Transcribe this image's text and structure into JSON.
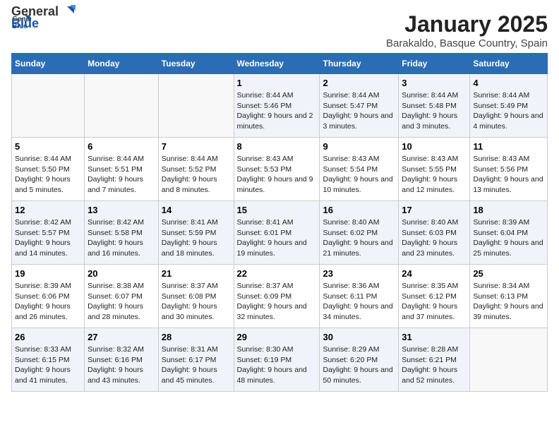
{
  "logo": {
    "general": "General",
    "blue": "Blue"
  },
  "title": "January 2025",
  "subtitle": "Barakaldo, Basque Country, Spain",
  "days_of_week": [
    "Sunday",
    "Monday",
    "Tuesday",
    "Wednesday",
    "Thursday",
    "Friday",
    "Saturday"
  ],
  "weeks": [
    [
      {
        "day": "",
        "content": ""
      },
      {
        "day": "",
        "content": ""
      },
      {
        "day": "",
        "content": ""
      },
      {
        "day": "1",
        "content": "Sunrise: 8:44 AM\nSunset: 5:46 PM\nDaylight: 9 hours and 2 minutes."
      },
      {
        "day": "2",
        "content": "Sunrise: 8:44 AM\nSunset: 5:47 PM\nDaylight: 9 hours and 3 minutes."
      },
      {
        "day": "3",
        "content": "Sunrise: 8:44 AM\nSunset: 5:48 PM\nDaylight: 9 hours and 3 minutes."
      },
      {
        "day": "4",
        "content": "Sunrise: 8:44 AM\nSunset: 5:49 PM\nDaylight: 9 hours and 4 minutes."
      }
    ],
    [
      {
        "day": "5",
        "content": "Sunrise: 8:44 AM\nSunset: 5:50 PM\nDaylight: 9 hours and 5 minutes."
      },
      {
        "day": "6",
        "content": "Sunrise: 8:44 AM\nSunset: 5:51 PM\nDaylight: 9 hours and 7 minutes."
      },
      {
        "day": "7",
        "content": "Sunrise: 8:44 AM\nSunset: 5:52 PM\nDaylight: 9 hours and 8 minutes."
      },
      {
        "day": "8",
        "content": "Sunrise: 8:43 AM\nSunset: 5:53 PM\nDaylight: 9 hours and 9 minutes."
      },
      {
        "day": "9",
        "content": "Sunrise: 8:43 AM\nSunset: 5:54 PM\nDaylight: 9 hours and 10 minutes."
      },
      {
        "day": "10",
        "content": "Sunrise: 8:43 AM\nSunset: 5:55 PM\nDaylight: 9 hours and 12 minutes."
      },
      {
        "day": "11",
        "content": "Sunrise: 8:43 AM\nSunset: 5:56 PM\nDaylight: 9 hours and 13 minutes."
      }
    ],
    [
      {
        "day": "12",
        "content": "Sunrise: 8:42 AM\nSunset: 5:57 PM\nDaylight: 9 hours and 14 minutes."
      },
      {
        "day": "13",
        "content": "Sunrise: 8:42 AM\nSunset: 5:58 PM\nDaylight: 9 hours and 16 minutes."
      },
      {
        "day": "14",
        "content": "Sunrise: 8:41 AM\nSunset: 5:59 PM\nDaylight: 9 hours and 18 minutes."
      },
      {
        "day": "15",
        "content": "Sunrise: 8:41 AM\nSunset: 6:01 PM\nDaylight: 9 hours and 19 minutes."
      },
      {
        "day": "16",
        "content": "Sunrise: 8:40 AM\nSunset: 6:02 PM\nDaylight: 9 hours and 21 minutes."
      },
      {
        "day": "17",
        "content": "Sunrise: 8:40 AM\nSunset: 6:03 PM\nDaylight: 9 hours and 23 minutes."
      },
      {
        "day": "18",
        "content": "Sunrise: 8:39 AM\nSunset: 6:04 PM\nDaylight: 9 hours and 25 minutes."
      }
    ],
    [
      {
        "day": "19",
        "content": "Sunrise: 8:39 AM\nSunset: 6:06 PM\nDaylight: 9 hours and 26 minutes."
      },
      {
        "day": "20",
        "content": "Sunrise: 8:38 AM\nSunset: 6:07 PM\nDaylight: 9 hours and 28 minutes."
      },
      {
        "day": "21",
        "content": "Sunrise: 8:37 AM\nSunset: 6:08 PM\nDaylight: 9 hours and 30 minutes."
      },
      {
        "day": "22",
        "content": "Sunrise: 8:37 AM\nSunset: 6:09 PM\nDaylight: 9 hours and 32 minutes."
      },
      {
        "day": "23",
        "content": "Sunrise: 8:36 AM\nSunset: 6:11 PM\nDaylight: 9 hours and 34 minutes."
      },
      {
        "day": "24",
        "content": "Sunrise: 8:35 AM\nSunset: 6:12 PM\nDaylight: 9 hours and 37 minutes."
      },
      {
        "day": "25",
        "content": "Sunrise: 8:34 AM\nSunset: 6:13 PM\nDaylight: 9 hours and 39 minutes."
      }
    ],
    [
      {
        "day": "26",
        "content": "Sunrise: 8:33 AM\nSunset: 6:15 PM\nDaylight: 9 hours and 41 minutes."
      },
      {
        "day": "27",
        "content": "Sunrise: 8:32 AM\nSunset: 6:16 PM\nDaylight: 9 hours and 43 minutes."
      },
      {
        "day": "28",
        "content": "Sunrise: 8:31 AM\nSunset: 6:17 PM\nDaylight: 9 hours and 45 minutes."
      },
      {
        "day": "29",
        "content": "Sunrise: 8:30 AM\nSunset: 6:19 PM\nDaylight: 9 hours and 48 minutes."
      },
      {
        "day": "30",
        "content": "Sunrise: 8:29 AM\nSunset: 6:20 PM\nDaylight: 9 hours and 50 minutes."
      },
      {
        "day": "31",
        "content": "Sunrise: 8:28 AM\nSunset: 6:21 PM\nDaylight: 9 hours and 52 minutes."
      },
      {
        "day": "",
        "content": ""
      }
    ]
  ]
}
